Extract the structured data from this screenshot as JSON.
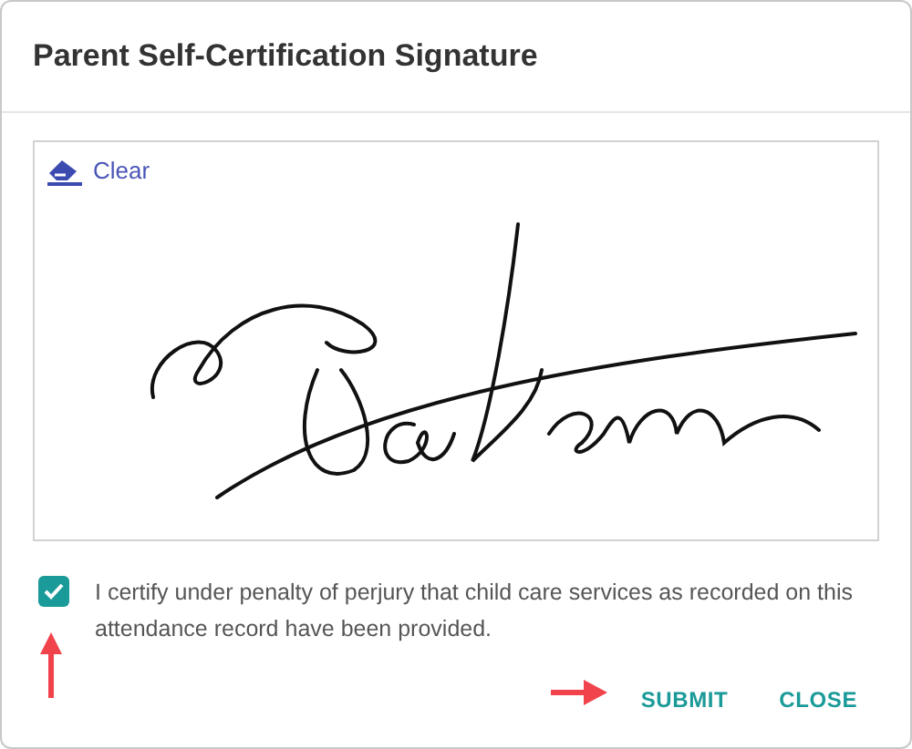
{
  "dialog": {
    "title": "Parent Self-Certification Signature"
  },
  "signature_pad": {
    "clear_label": "Clear"
  },
  "certification": {
    "checked": true,
    "text": "I certify under penalty of perjury that child care services as recorded on this attendance record have been provided."
  },
  "buttons": [
    {
      "label": "SUBMIT"
    },
    {
      "label": "CLOSE"
    }
  ]
}
